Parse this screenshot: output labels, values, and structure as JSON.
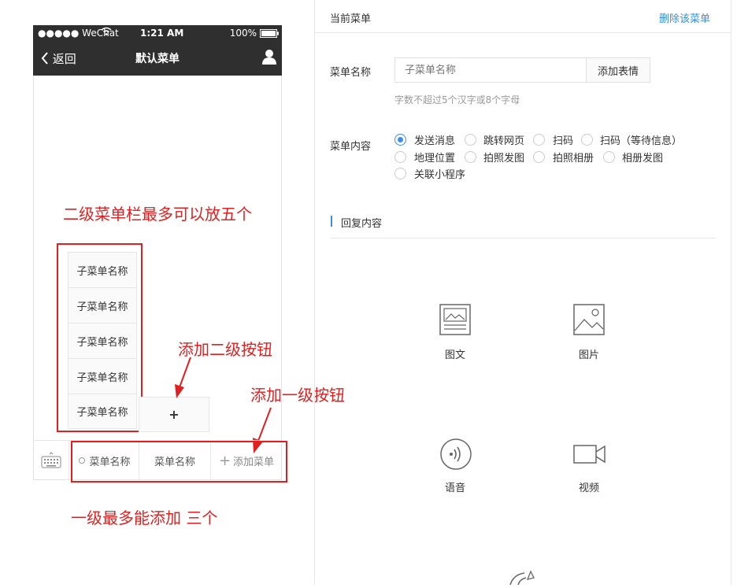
{
  "phone": {
    "status": {
      "carrier": "●●●●● WeChat",
      "time": "1:21 AM",
      "battery": "100%"
    },
    "nav": {
      "back_label": "返回",
      "title": "默认菜单"
    },
    "submenu_items": [
      "子菜单名称",
      "子菜单名称",
      "子菜单名称",
      "子菜单名称",
      "子菜单名称"
    ],
    "add_sub_label": "+",
    "main_menus": [
      "菜单名称",
      "菜单名称"
    ],
    "add_main_label": "添加菜单"
  },
  "annotations": {
    "sub_limit": "二级菜单栏最多可以放五个",
    "add_sub": "添加二级按钮",
    "add_main": "添加一级按钮",
    "main_limit": "一级最多能添加 三个"
  },
  "panel": {
    "header": {
      "title": "当前菜单",
      "delete_label": "删除该菜单"
    },
    "name_field": {
      "label": "菜单名称",
      "placeholder": "子菜单名称",
      "emoji_button": "添加表情",
      "hint": "字数不超过5个汉字或8个字母"
    },
    "content": {
      "label": "菜单内容",
      "options": [
        "发送消息",
        "跳转网页",
        "扫码",
        "扫码（等待信息）",
        "地理位置",
        "拍照发图",
        "拍照相册",
        "相册发图",
        "关联小程序"
      ],
      "selected": "发送消息"
    },
    "reply": {
      "title": "回复内容"
    },
    "media": [
      "图文",
      "图片",
      "语音",
      "视频"
    ]
  },
  "colors": {
    "accent": "#3a8ee6",
    "annotation": "#e02020",
    "nav_bg": "#2f2f2f"
  }
}
